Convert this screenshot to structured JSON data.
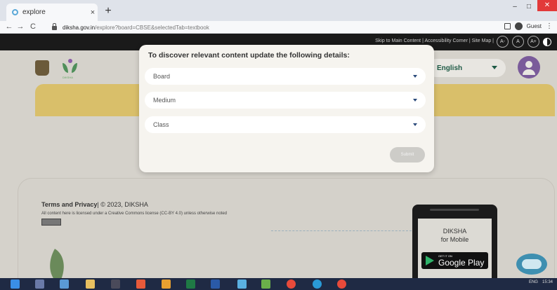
{
  "browser": {
    "tab_title": "explore",
    "tab_close": "×",
    "new_tab": "+",
    "url_domain": "diksha.gov.in",
    "url_path": "/explore?board=CBSE&selectedTab=textbook",
    "guest_label": "Guest",
    "window_minimize": "–",
    "window_maximize": "□",
    "window_close": "✕",
    "back": "←",
    "forward": "→",
    "reload": "C",
    "menu": "⋮"
  },
  "site_header": {
    "links": "Skip to Main Content | Accessibility Corner | Site Map |",
    "font_buttons": [
      "A-",
      "A",
      "A+"
    ],
    "language": "English",
    "logo_sublabel": "DIKSHA"
  },
  "modal": {
    "title": "To discover relevant content update the following details:",
    "fields": [
      {
        "placeholder": "Board"
      },
      {
        "placeholder": "Medium"
      },
      {
        "placeholder": "Class"
      }
    ],
    "submit_label": "Submit"
  },
  "footer": {
    "terms_label": "Terms and Privacy",
    "copyright": "| © 2023, DIKSHA",
    "license": "All content here is licensed under a Creative Commons license (CC-BY 4.0) unless otherwise noted",
    "app_title_line1": "DIKSHA",
    "app_title_line2": "for Mobile",
    "store_small": "GET IT ON",
    "store_big": "Google Play"
  },
  "taskbar": {
    "lang": "ENG",
    "time": "15:34"
  }
}
